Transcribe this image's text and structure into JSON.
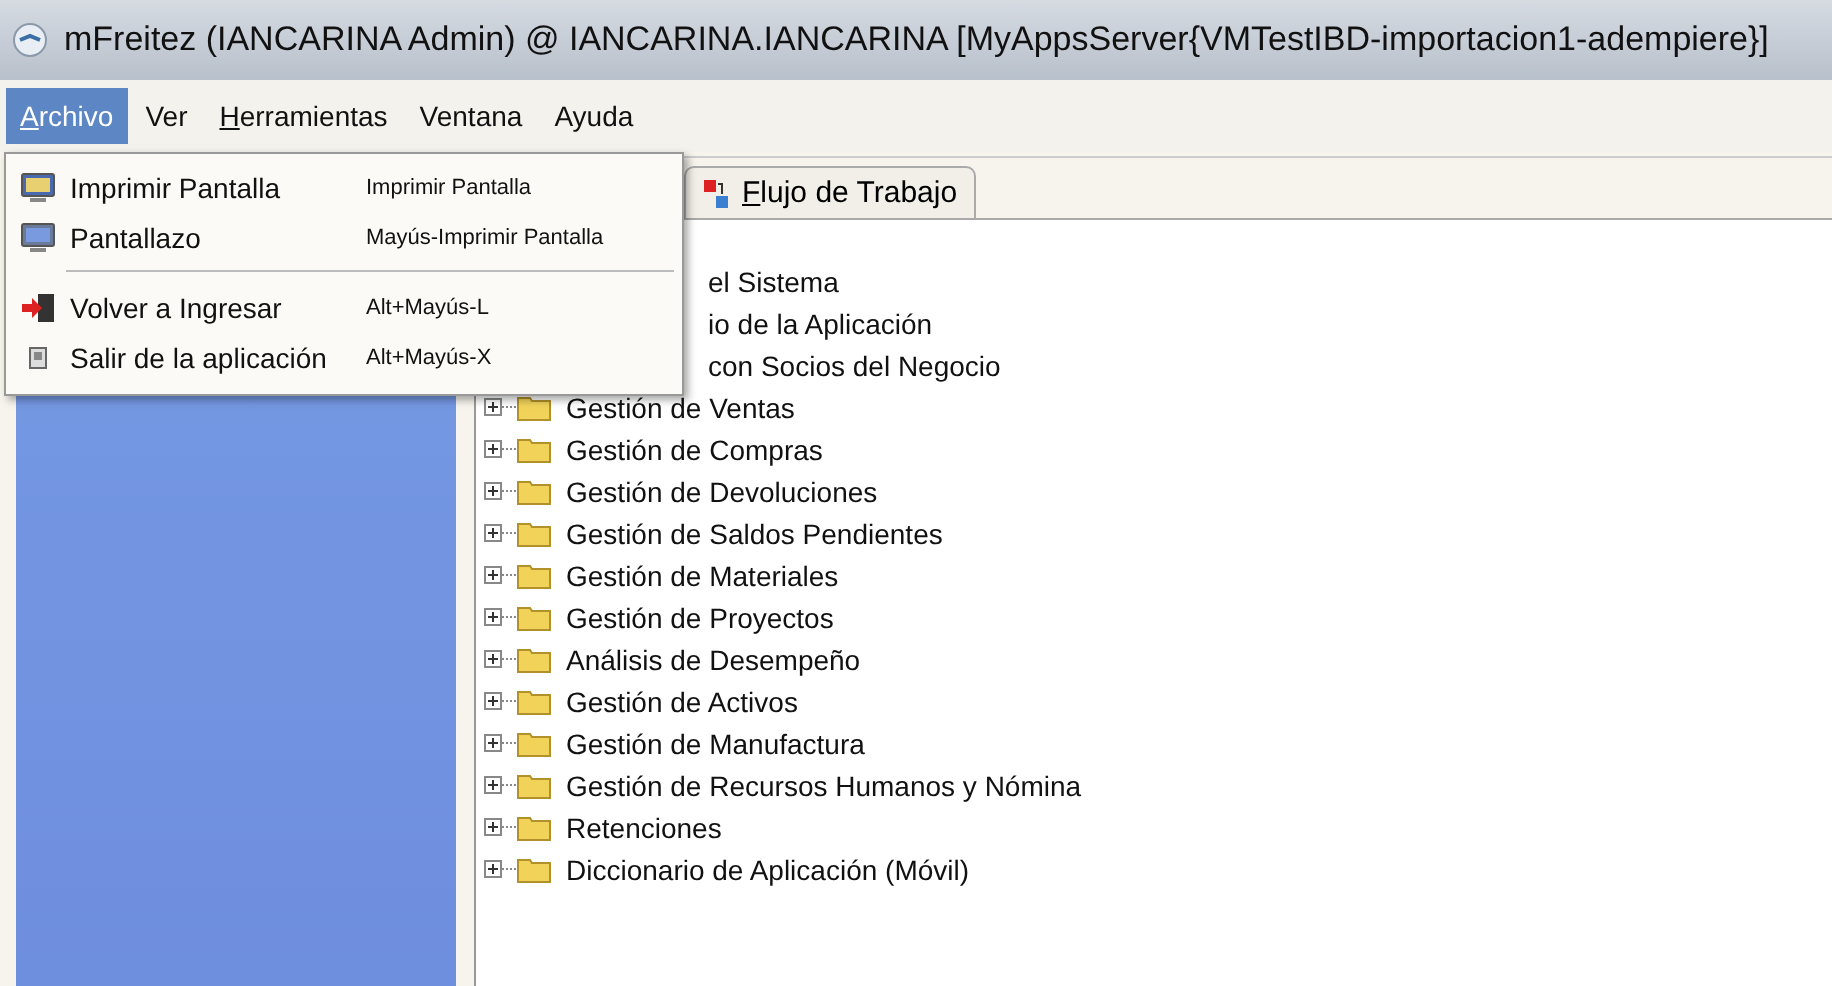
{
  "window": {
    "title": "mFreitez (IANCARINA Admin) @ IANCARINA.IANCARINA [MyAppsServer{VMTestIBD-importacion1-adempiere}]"
  },
  "menu_bar": [
    {
      "label": "Archivo",
      "selected": true,
      "underline_first": true
    },
    {
      "label": "Ver",
      "selected": false,
      "underline_first": false
    },
    {
      "label": "Herramientas",
      "selected": false,
      "underline_first": true
    },
    {
      "label": "Ventana",
      "selected": false,
      "underline_first": false
    },
    {
      "label": "Ayuda",
      "selected": false,
      "underline_first": false
    }
  ],
  "open_menu": {
    "items": [
      {
        "kind": "item",
        "label": "Imprimir Pantalla",
        "shortcut": "Imprimir Pantalla"
      },
      {
        "kind": "item",
        "label": "Pantallazo",
        "shortcut": "Mayús-Imprimir Pantalla"
      },
      {
        "kind": "separator"
      },
      {
        "kind": "item",
        "label": "Volver a Ingresar",
        "shortcut": "Alt+Mayús-L"
      },
      {
        "kind": "item",
        "label": "Salir de la aplicación",
        "shortcut": "Alt+Mayús-X"
      }
    ]
  },
  "tabs": [
    {
      "label": "Flujo de Trabajo",
      "selected": false,
      "underline_first": true
    }
  ],
  "tree": {
    "items": [
      {
        "kind": "covered",
        "label": "el Sistema"
      },
      {
        "kind": "covered",
        "label": "io de la Aplicación"
      },
      {
        "kind": "covered",
        "label": "con Socios del Negocio"
      },
      {
        "kind": "folder",
        "label": "Gestión de Ventas"
      },
      {
        "kind": "folder",
        "label": "Gestión de Compras"
      },
      {
        "kind": "folder",
        "label": "Gestión de Devoluciones"
      },
      {
        "kind": "folder",
        "label": "Gestión de Saldos Pendientes"
      },
      {
        "kind": "folder",
        "label": "Gestión de Materiales"
      },
      {
        "kind": "folder",
        "label": "Gestión de Proyectos"
      },
      {
        "kind": "folder",
        "label": "Análisis de Desempeño"
      },
      {
        "kind": "folder",
        "label": "Gestión de Activos"
      },
      {
        "kind": "folder",
        "label": "Gestión de Manufactura"
      },
      {
        "kind": "folder",
        "label": "Gestión de Recursos Humanos y Nómina"
      },
      {
        "kind": "folder",
        "label": "Retenciones"
      },
      {
        "kind": "folder",
        "label": "Diccionario de Aplicación (Móvil)"
      }
    ]
  }
}
